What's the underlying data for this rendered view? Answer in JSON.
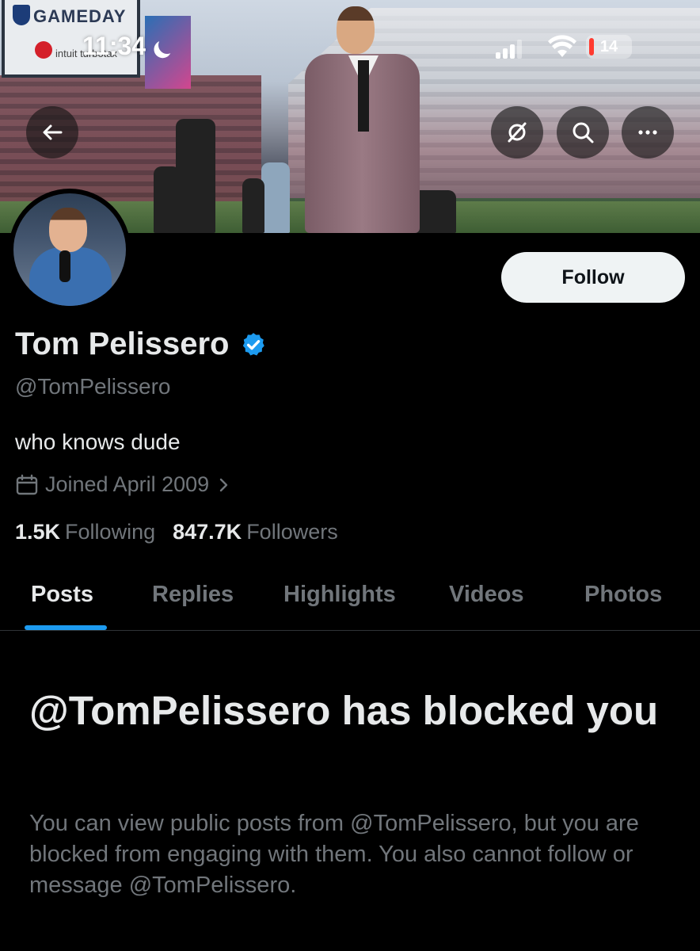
{
  "status_bar": {
    "time": "11:34",
    "battery": "14"
  },
  "banner": {
    "scoreboard_text": "GAMEDAY",
    "scoreboard_sub": "intuit turbotax"
  },
  "actions": {
    "back_icon": "arrow-left-icon",
    "grok_icon": "grok-icon",
    "search_icon": "search-icon",
    "more_icon": "more-icon"
  },
  "profile": {
    "name": "Tom Pelissero",
    "handle": "@TomPelissero",
    "bio": "who knows dude",
    "joined": "Joined April 2009",
    "following_count": "1.5K",
    "following_label": "Following",
    "followers_count": "847.7K",
    "followers_label": "Followers"
  },
  "follow_label": "Follow",
  "tabs": [
    {
      "label": "Posts"
    },
    {
      "label": "Replies"
    },
    {
      "label": "Highlights"
    },
    {
      "label": "Videos"
    },
    {
      "label": "Photos"
    }
  ],
  "blocked": {
    "title": "@TomPelissero has blocked you",
    "description": "You can view public posts from @TomPelissero, but you are blocked from engaging with them. You also cannot follow or message @TomPelissero."
  },
  "colors": {
    "background": "#000000",
    "accent": "#1d9bf0",
    "text_primary": "#e7e9ea",
    "text_secondary": "#71767b"
  }
}
